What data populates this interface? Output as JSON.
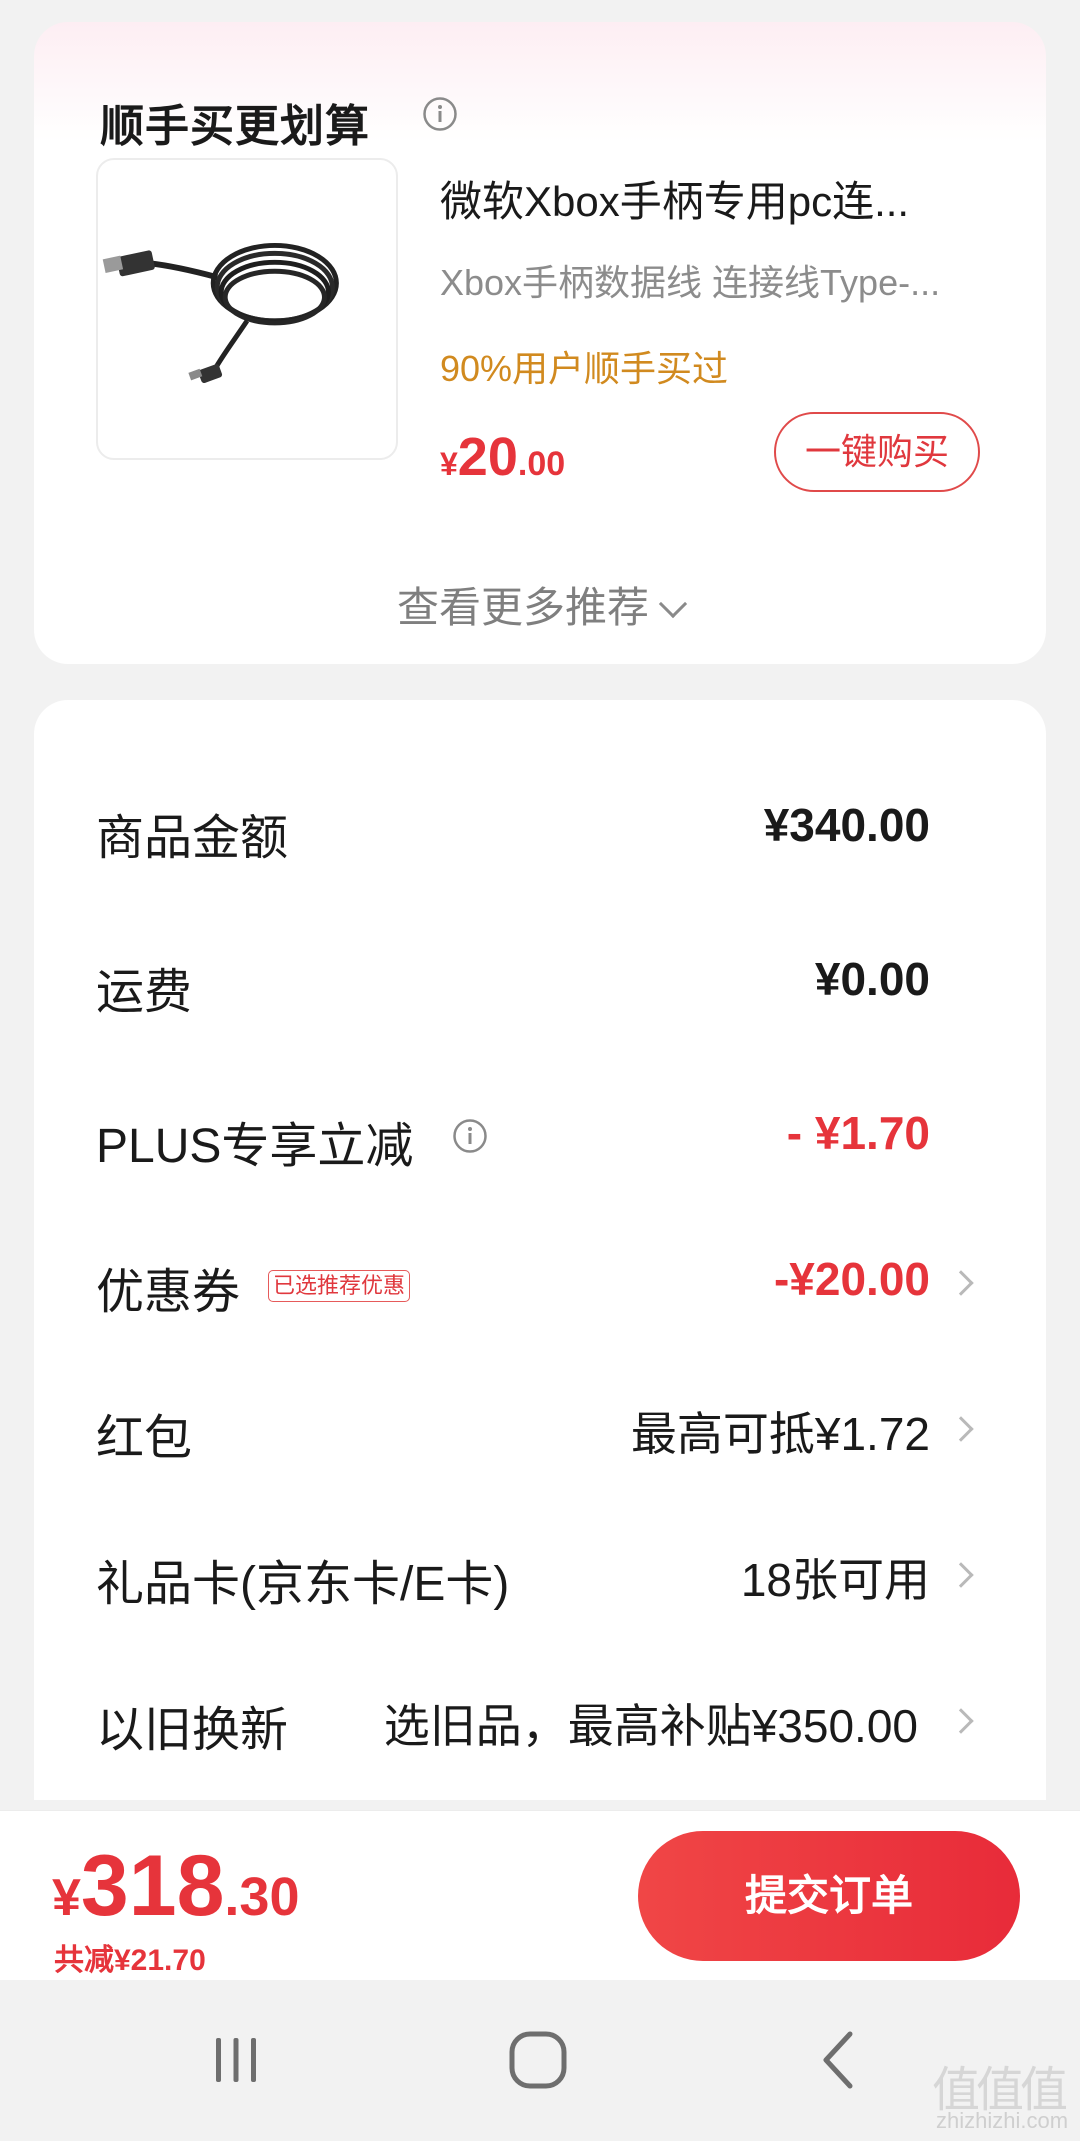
{
  "recommendation": {
    "title": "顺手买更划算",
    "product": {
      "title": "微软Xbox手柄专用pc连...",
      "subtitle": "Xbox手柄数据线 连接线Type-...",
      "note": "90%用户顺手买过",
      "price_currency": "¥",
      "price_int": "20",
      "price_dec": ".00",
      "buy_label": "一键购买"
    },
    "more_label": "查看更多推荐"
  },
  "summary": {
    "rows": [
      {
        "label": "商品金额",
        "value": "¥340.00"
      },
      {
        "label": "运费",
        "value": "¥0.00"
      },
      {
        "label": "PLUS专享立减",
        "value": "- ¥1.70"
      },
      {
        "label": "优惠券",
        "badge": "已选推荐优惠",
        "value": "-¥20.00"
      },
      {
        "label": "红包",
        "value": "最高可抵¥1.72"
      },
      {
        "label": "礼品卡(京东卡/E卡)",
        "value": "18张可用"
      },
      {
        "label": "以旧换新",
        "value": "选旧品，最高补贴¥350.00"
      }
    ]
  },
  "footer": {
    "total_currency": "¥",
    "total_int": "318",
    "total_dec": ".30",
    "saved": "共减¥21.70",
    "submit_label": "提交订单"
  },
  "watermark": {
    "logo": "值值值",
    "text": "zhizhizhi.com"
  },
  "colors": {
    "accent": "#e6343b",
    "note": "#d18a1f",
    "background": "#f2f2f2"
  }
}
